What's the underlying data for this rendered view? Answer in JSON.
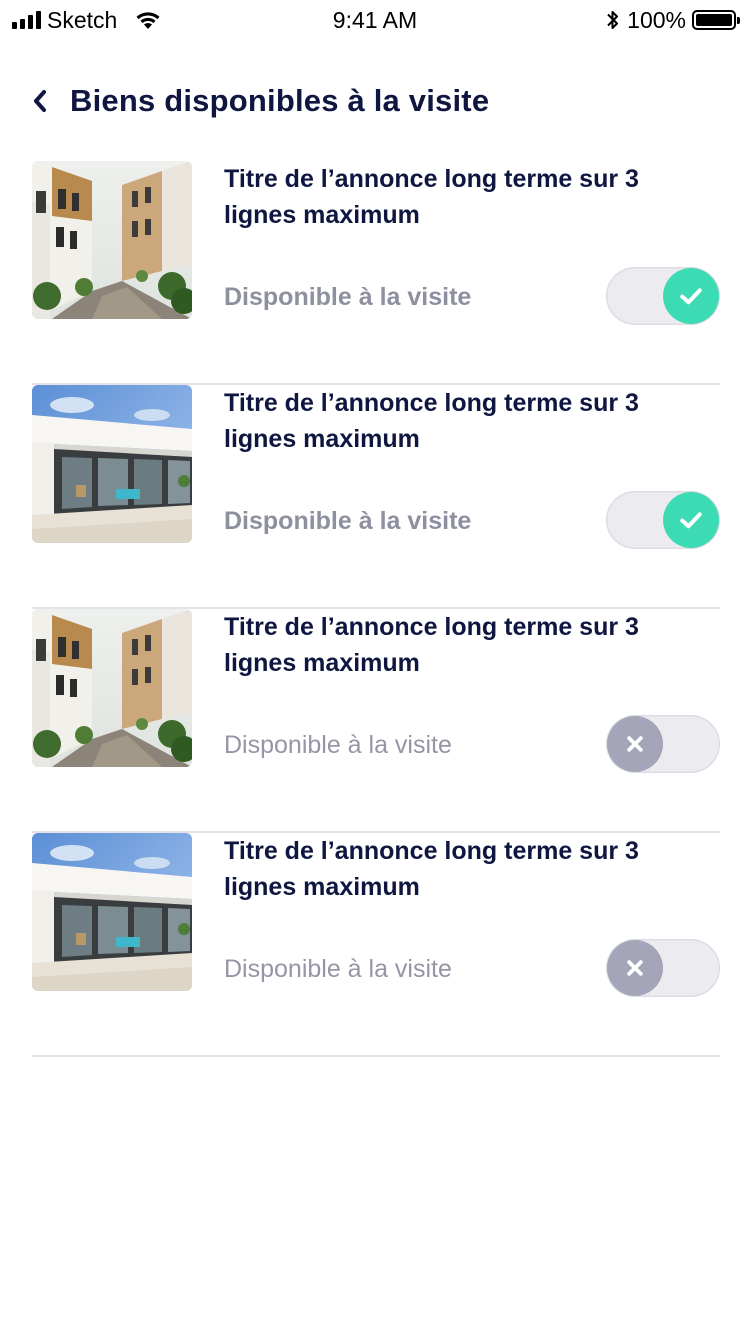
{
  "status_bar": {
    "carrier": "Sketch",
    "time": "9:41 AM",
    "battery": "100%"
  },
  "header": {
    "back_icon": "chevron-left-icon",
    "title": "Biens disponibles à la visite"
  },
  "colors": {
    "title": "#0f1640",
    "toggle_on": "#3ddbb4",
    "toggle_off": "#a4a5b9",
    "muted_text": "#9496a6",
    "divider": "#e3e4ea"
  },
  "listings": [
    {
      "title": "Titre de l’annonce long terme sur 3 lignes maximum",
      "availability_label": "Disponible à la visite",
      "available": true,
      "photo": "street-townhouses-photo"
    },
    {
      "title": "Titre de l’annonce long terme sur 3 lignes maximum",
      "availability_label": "Disponible à la visite",
      "available": true,
      "photo": "modern-house-photo"
    },
    {
      "title": "Titre de l’annonce long terme sur 3 lignes maximum",
      "availability_label": "Disponible à la visite",
      "available": false,
      "photo": "street-townhouses-photo"
    },
    {
      "title": "Titre de l’annonce long terme sur 3 lignes maximum",
      "availability_label": "Disponible à la visite",
      "available": false,
      "photo": "modern-house-photo"
    }
  ]
}
